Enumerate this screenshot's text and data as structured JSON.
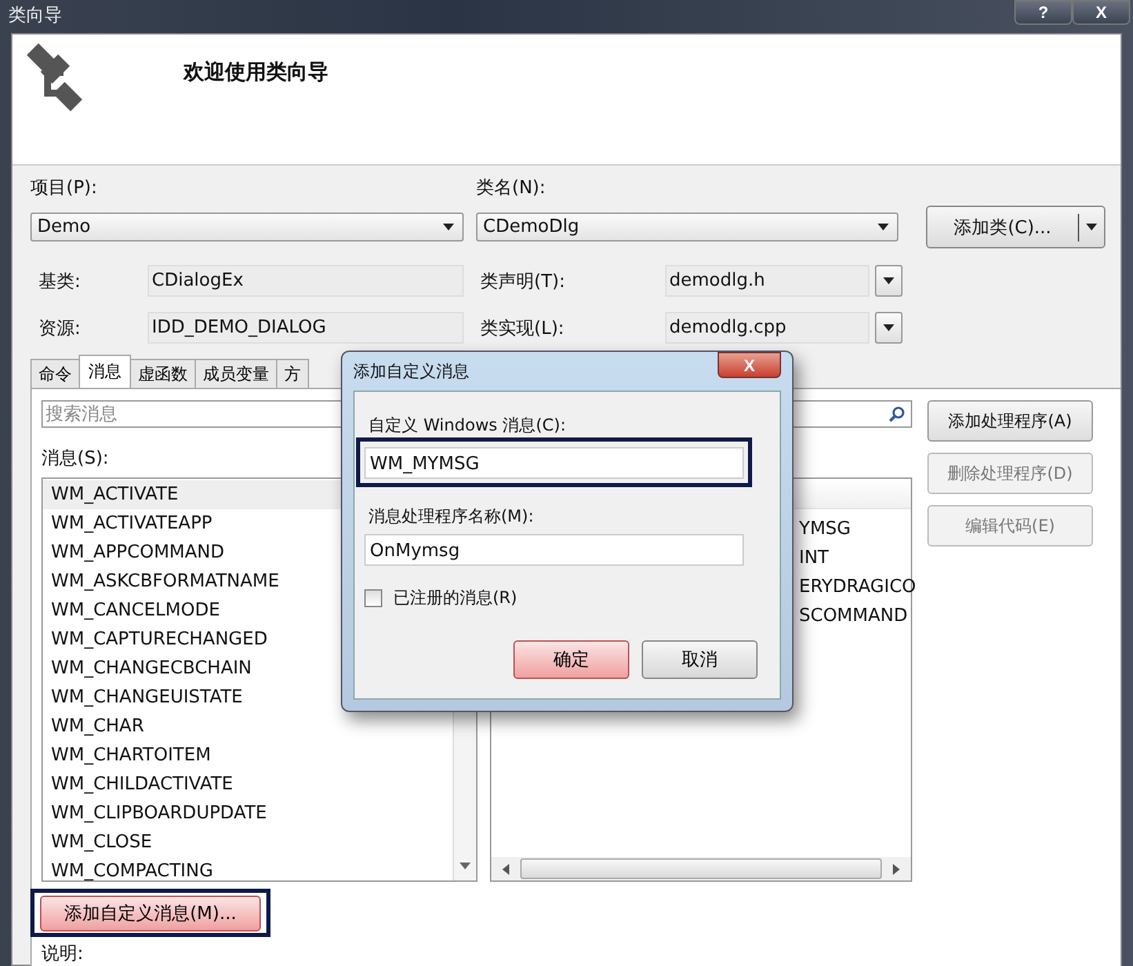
{
  "window": {
    "title": "类向导",
    "help_button": "?",
    "close_button": "X"
  },
  "header": {
    "heading": "欢迎使用类向导"
  },
  "project": {
    "label": "项目(P):",
    "value": "Demo"
  },
  "class_name": {
    "label": "类名(N):",
    "value": "CDemoDlg"
  },
  "add_class_button": "添加类(C)...",
  "base_class": {
    "label": "基类:",
    "value": "CDialogEx"
  },
  "class_declaration": {
    "label": "类声明(T):",
    "value": "demodlg.h"
  },
  "resource": {
    "label": "资源:",
    "value": "IDD_DEMO_DIALOG"
  },
  "class_implementation": {
    "label": "类实现(L):",
    "value": "demodlg.cpp"
  },
  "tabs": [
    {
      "label": "命令",
      "selected": false
    },
    {
      "label": "消息",
      "selected": true
    },
    {
      "label": "虚函数",
      "selected": false
    },
    {
      "label": "成员变量",
      "selected": false
    },
    {
      "label": "方",
      "selected": false
    }
  ],
  "search": {
    "placeholder": "搜索消息"
  },
  "messages_label": "消息(S):",
  "messages": [
    {
      "name": "WM_ACTIVATE",
      "selected": true
    },
    {
      "name": "WM_ACTIVATEAPP",
      "selected": false
    },
    {
      "name": "WM_APPCOMMAND",
      "selected": false
    },
    {
      "name": "WM_ASKCBFORMATNAME",
      "selected": false
    },
    {
      "name": "WM_CANCELMODE",
      "selected": false
    },
    {
      "name": "WM_CAPTURECHANGED",
      "selected": false
    },
    {
      "name": "WM_CHANGECBCHAIN",
      "selected": false
    },
    {
      "name": "WM_CHANGEUISTATE",
      "selected": false
    },
    {
      "name": "WM_CHAR",
      "selected": false
    },
    {
      "name": "WM_CHARTOITEM",
      "selected": false
    },
    {
      "name": "WM_CHILDACTIVATE",
      "selected": false
    },
    {
      "name": "WM_CLIPBOARDUPDATE",
      "selected": false
    },
    {
      "name": "WM_CLOSE",
      "selected": false
    },
    {
      "name": "WM_COMPACTING",
      "selected": false
    }
  ],
  "handlers": [
    "YMSG",
    "INT",
    "ERYDRAGICO",
    "SCOMMAND"
  ],
  "side_buttons": [
    {
      "label": "添加处理程序(A)",
      "disabled": false
    },
    {
      "label": "删除处理程序(D)",
      "disabled": true
    },
    {
      "label": "编辑代码(E)",
      "disabled": true
    }
  ],
  "add_custom_button": {
    "label": "添加自定义消息(M)...",
    "highlighted": true
  },
  "description_label": "说明:",
  "dialog": {
    "title": "添加自定义消息",
    "close_button": "X",
    "message_label": "自定义 Windows 消息(C):",
    "message_value": "WM_MYMSG",
    "message_highlighted": true,
    "handler_label": "消息处理程序名称(M):",
    "handler_value": "OnMymsg",
    "registered": {
      "label": "已注册的消息(R)",
      "checked": false
    },
    "ok_button": "确定",
    "cancel_button": "取消"
  }
}
